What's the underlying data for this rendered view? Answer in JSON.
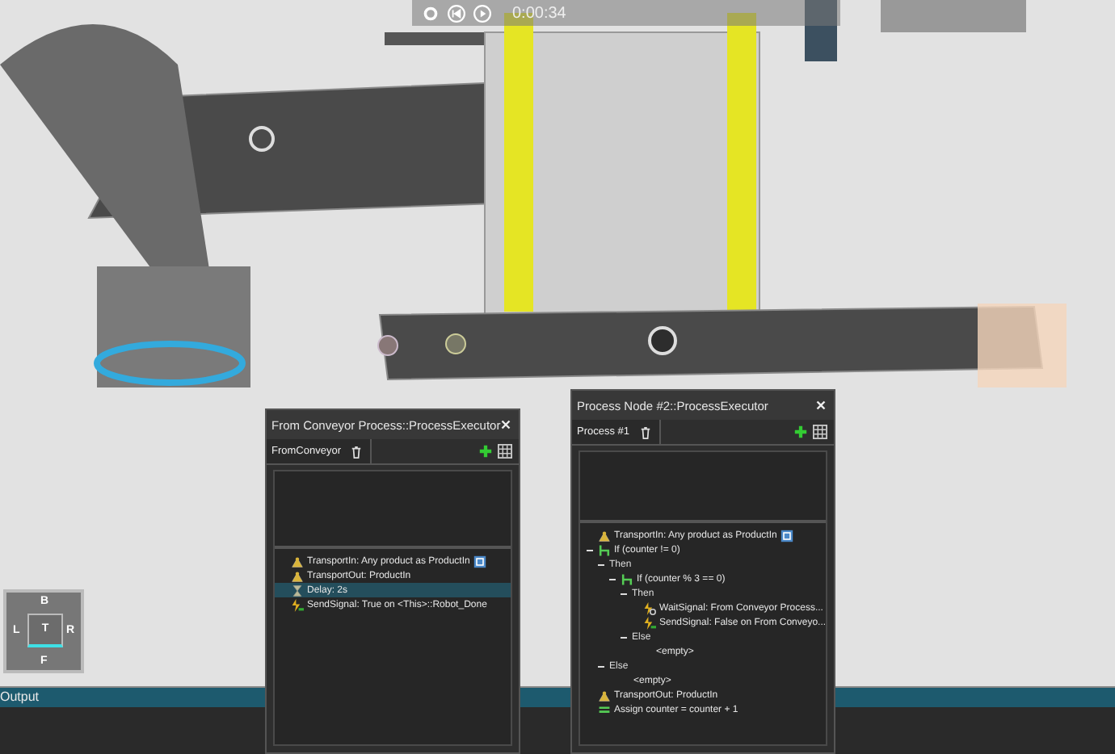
{
  "playback_bar": {
    "time": "0:00:34"
  },
  "view_cube": {
    "top": "B",
    "left": "L",
    "center": "T",
    "right": "R",
    "bottom": "F"
  },
  "output_bar": {
    "label": "Output"
  },
  "panels": [
    {
      "title": "From Conveyor Process::ProcessExecutor",
      "tab": {
        "label": "FromConveyor",
        "selected": true
      },
      "rows": [
        {
          "kind": "transport_in",
          "text": "TransportIn: Any product as ProductIn",
          "selected": false
        },
        {
          "kind": "transport_out",
          "text": "TransportOut: ProductIn",
          "selected": false
        },
        {
          "kind": "delay",
          "text": "Delay: 2s",
          "selected": true
        },
        {
          "kind": "send_signal",
          "text": "SendSignal: True on <This>::Robot_Done",
          "selected": false
        }
      ]
    },
    {
      "title": "Process Node #2::ProcessExecutor",
      "tab": {
        "label": "Process #1",
        "selected": true
      },
      "rows": [
        {
          "kind": "transport_in",
          "text": "TransportIn: Any product as ProductIn",
          "selected": false
        },
        {
          "kind": "if",
          "text": "If (counter != 0)",
          "selected": false,
          "expanded": true,
          "children": [
            {
              "kind": "clause",
              "text": "Then",
              "selected": false,
              "expanded": true,
              "children": [
                {
                  "kind": "if",
                  "text": "If (counter % 3 == 0)",
                  "selected": false,
                  "expanded": true,
                  "children": [
                    {
                      "kind": "clause",
                      "text": "Then",
                      "selected": false,
                      "expanded": true,
                      "children": [
                        {
                          "kind": "wait_signal",
                          "text": "WaitSignal: From Conveyor Process...",
                          "selected": false
                        },
                        {
                          "kind": "send_signal",
                          "text": "SendSignal: False on From Conveyo...",
                          "selected": false
                        }
                      ]
                    },
                    {
                      "kind": "clause",
                      "text": "Else",
                      "selected": false,
                      "expanded": true,
                      "children": [
                        {
                          "kind": "empty",
                          "text": "<empty>",
                          "selected": false
                        }
                      ]
                    }
                  ]
                }
              ]
            },
            {
              "kind": "clause",
              "text": "Else",
              "selected": false,
              "expanded": true,
              "children": [
                {
                  "kind": "empty",
                  "text": "<empty>",
                  "selected": false
                }
              ]
            }
          ]
        },
        {
          "kind": "transport_out",
          "text": "TransportOut: ProductIn",
          "selected": false
        },
        {
          "kind": "assign",
          "text": "Assign counter = counter + 1",
          "selected": false
        }
      ]
    }
  ]
}
